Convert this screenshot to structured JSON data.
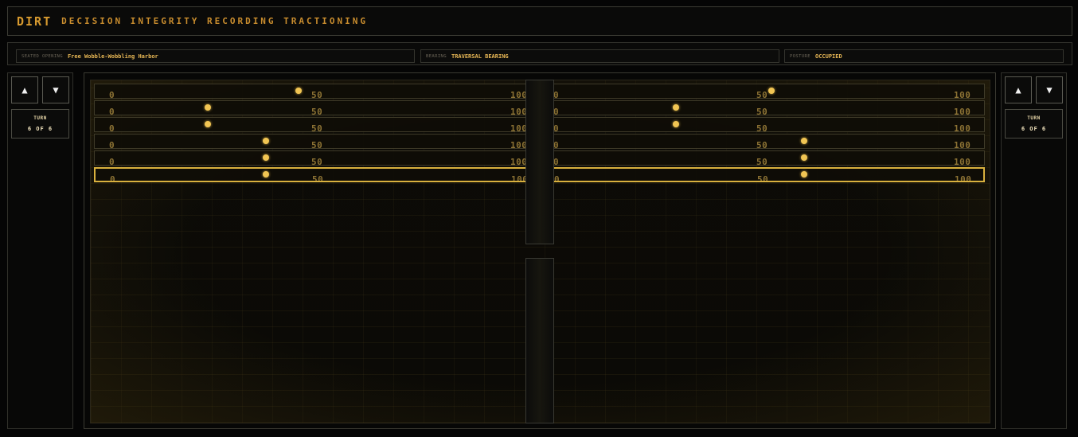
{
  "header": {
    "brand": "DIRT",
    "subtitle": "DECISION INTEGRITY RECORDING TRACTIONING"
  },
  "info": [
    {
      "key": "SEATED OPENING",
      "value": "Free Wobble-Wobbling Harbor"
    },
    {
      "key": "BEARING",
      "value": "TRAVERSAL BEARING"
    },
    {
      "key": "POSTURE",
      "value": "OCCUPIED"
    }
  ],
  "left_panel": {
    "up": "▲",
    "down": "▼",
    "turn_label": "TURN",
    "turn_value": "6 OF 6"
  },
  "right_panel": {
    "up": "▲",
    "down": "▼",
    "turn_label": "TURN",
    "turn_value": "6 OF 6"
  },
  "scale_labels": {
    "min": "0",
    "mid": "50",
    "max": "100"
  },
  "active_row": 5,
  "tracks": {
    "left": [
      46,
      24,
      24,
      38,
      38,
      38
    ],
    "right": [
      53,
      30,
      30,
      61,
      61,
      61
    ]
  },
  "colors": {
    "accent": "#d79a2f",
    "dot": "#f1c553",
    "active_border": "#d9b13e"
  }
}
